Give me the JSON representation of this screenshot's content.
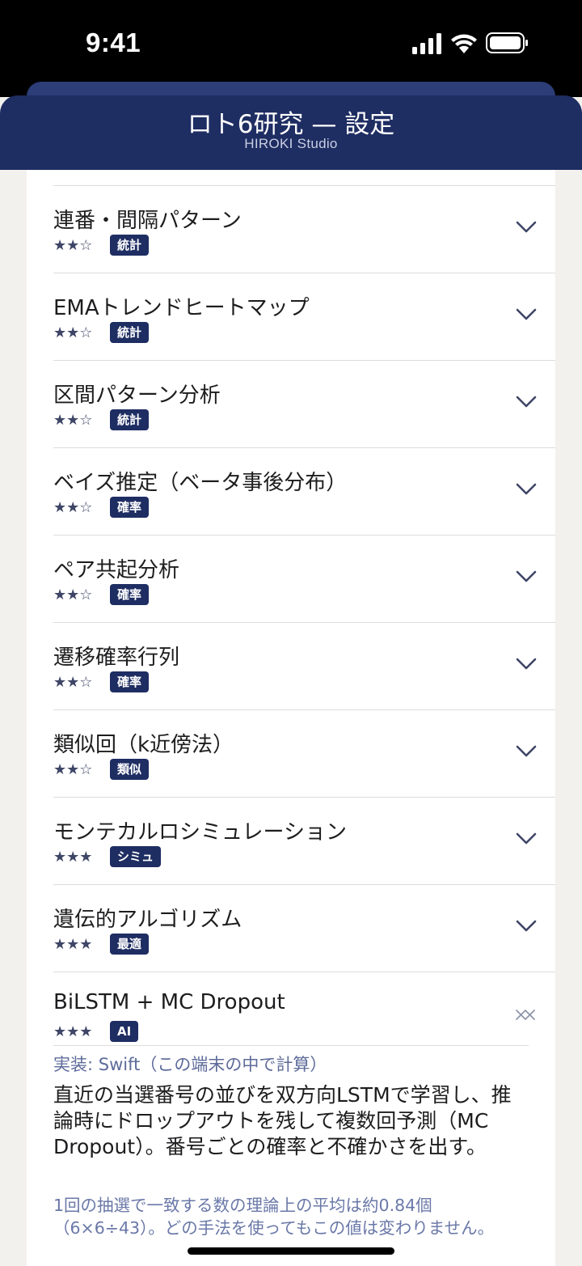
{
  "status_bar": {
    "time": "9:41"
  },
  "header": {
    "title": "ロト6研究 — 設定",
    "subtitle": "HIROKI Studio"
  },
  "methods": [
    {
      "title": "連番・間隔パターン",
      "stars": "★★☆",
      "badge": "統計",
      "icon": "chevron-down-icon"
    },
    {
      "title": "EMAトレンドヒートマップ",
      "stars": "★★☆",
      "badge": "統計",
      "icon": "chevron-down-icon"
    },
    {
      "title": "区間パターン分析",
      "stars": "★★☆",
      "badge": "統計",
      "icon": "chevron-down-icon"
    },
    {
      "title": "ベイズ推定（ベータ事後分布）",
      "stars": "★★☆",
      "badge": "確率",
      "icon": "chevron-down-icon"
    },
    {
      "title": "ペア共起分析",
      "stars": "★★☆",
      "badge": "確率",
      "icon": "chevron-down-icon"
    },
    {
      "title": "遷移確率行列",
      "stars": "★★☆",
      "badge": "確率",
      "icon": "chevron-down-icon"
    },
    {
      "title": "類似回（k近傍法）",
      "stars": "★★☆",
      "badge": "類似",
      "icon": "chevron-down-icon"
    },
    {
      "title": "モンテカルロシミュレーション",
      "stars": "★★★",
      "badge": "シミュ",
      "icon": "chevron-down-icon"
    },
    {
      "title": "遺伝的アルゴリズム",
      "stars": "★★★",
      "badge": "最適",
      "icon": "chevron-down-icon"
    },
    {
      "title": "BiLSTM + MC Dropout",
      "stars": "★★★",
      "badge": "AI",
      "icon": "close-icon"
    }
  ],
  "expanded": {
    "implementation": "実装: Swift（この端末の中で計算）",
    "description": "直近の当選番号の並びを双方向LSTMで学習し、推論時にドロップアウトを残して複数回予測（MC Dropout）。番号ごとの確率と不確かさを出す。",
    "note": "1回の抽選で一致する数の理論上の平均は約0.84個（6×6÷43）。どの手法を使ってもこの値は変わりません。"
  },
  "colors": {
    "header": "#1e2d62",
    "badge": "#1e2d62",
    "accent_text": "#6a78a8"
  }
}
